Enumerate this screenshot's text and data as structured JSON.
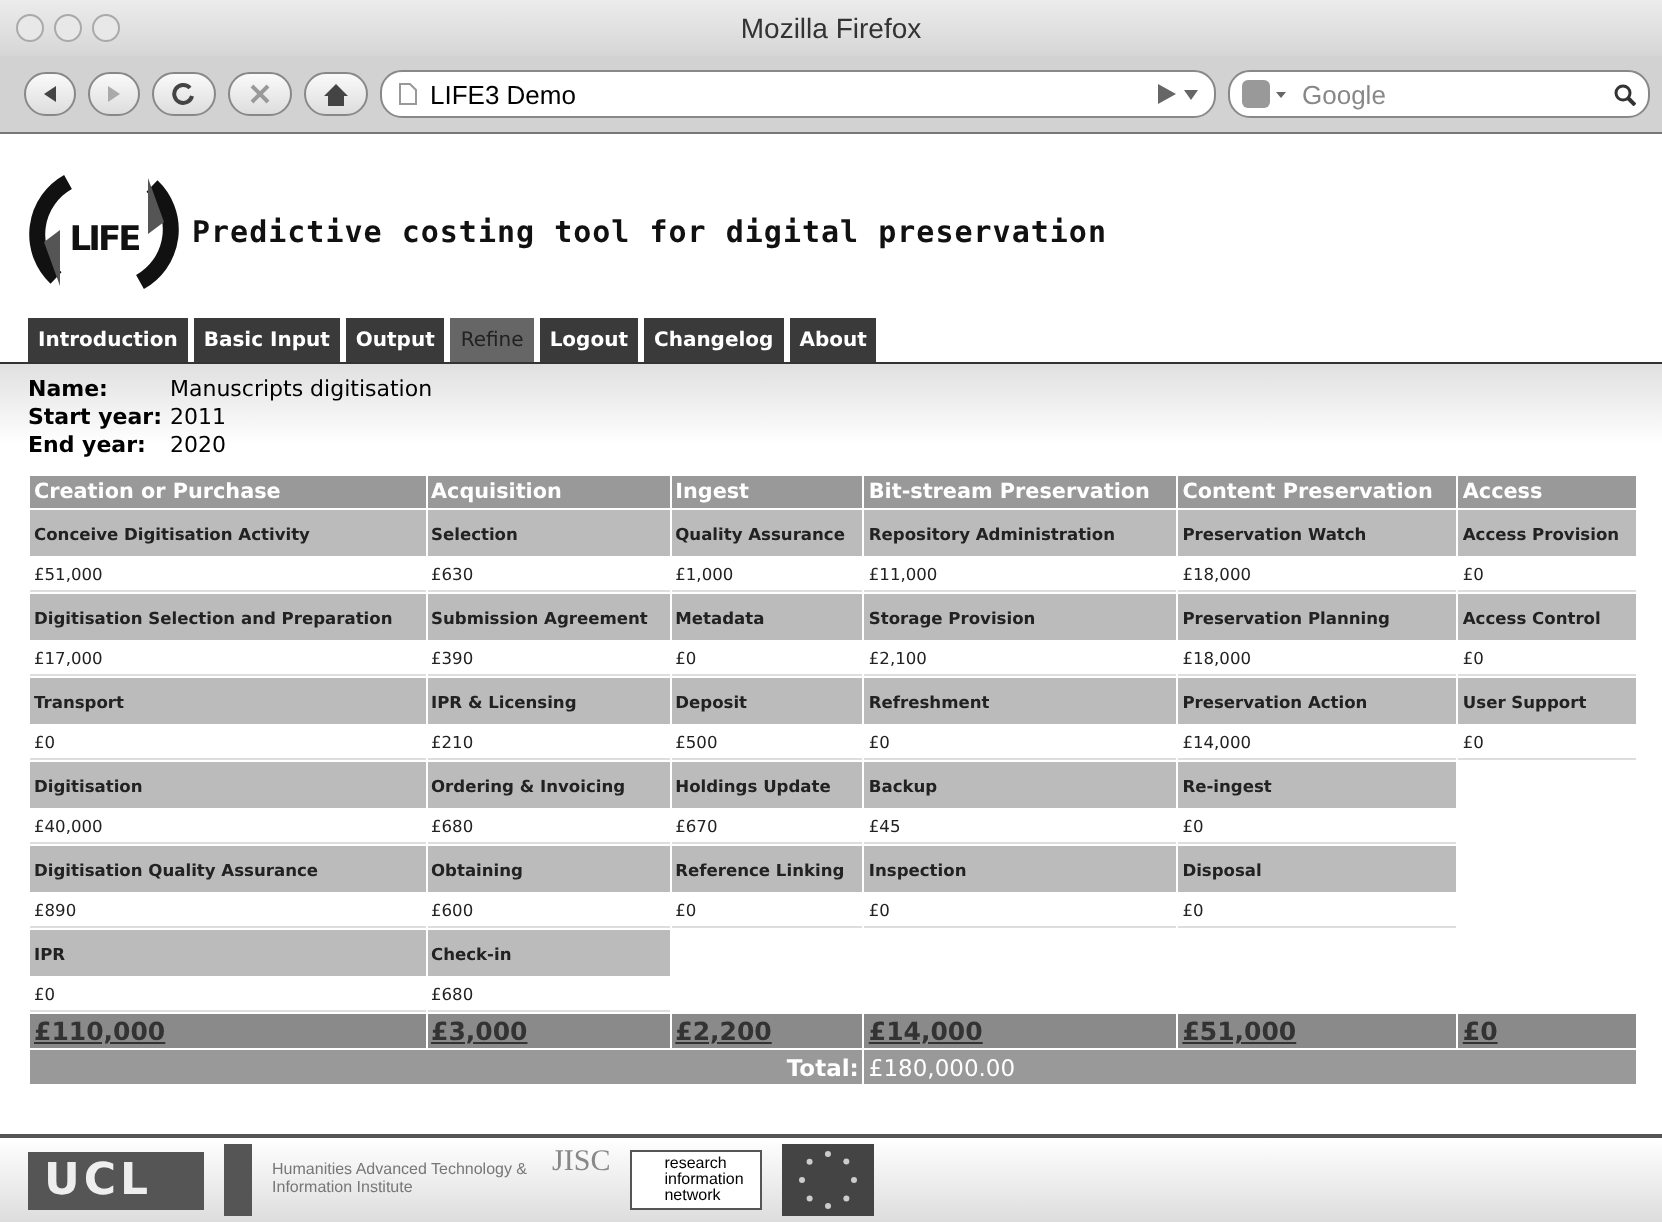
{
  "window": {
    "title": "Mozilla Firefox"
  },
  "toolbar": {
    "address": "LIFE3 Demo",
    "search": {
      "placeholder": "Google"
    }
  },
  "header": {
    "logo": "LIFE",
    "title": "Predictive costing tool for digital preservation"
  },
  "tabs": [
    {
      "label": "Introduction",
      "selected": false
    },
    {
      "label": "Basic Input",
      "selected": false
    },
    {
      "label": "Output",
      "selected": false
    },
    {
      "label": "Refine",
      "selected": true
    },
    {
      "label": "Logout",
      "selected": false
    },
    {
      "label": "Changelog",
      "selected": false
    },
    {
      "label": "About",
      "selected": false
    }
  ],
  "project": [
    {
      "label": "Name:",
      "value": "Manuscripts digitisation"
    },
    {
      "label": "Start year:",
      "value": "2011"
    },
    {
      "label": "End year:",
      "value": "2020"
    }
  ],
  "table": {
    "columns": [
      {
        "heading": "Creation or Purchase",
        "total": "£110,000",
        "items": [
          {
            "label": "Conceive Digitisation Activity",
            "value": "£51,000"
          },
          {
            "label": "Digitisation Selection and Preparation",
            "value": "£17,000"
          },
          {
            "label": "Transport",
            "value": "£0"
          },
          {
            "label": "Digitisation",
            "value": "£40,000"
          },
          {
            "label": "Digitisation Quality Assurance",
            "value": "£890"
          },
          {
            "label": "IPR",
            "value": "£0"
          }
        ]
      },
      {
        "heading": "Acquisition",
        "total": "£3,000",
        "items": [
          {
            "label": "Selection",
            "value": "£630"
          },
          {
            "label": "Submission Agreement",
            "value": "£390"
          },
          {
            "label": "IPR & Licensing",
            "value": "£210"
          },
          {
            "label": "Ordering & Invoicing",
            "value": "£680"
          },
          {
            "label": "Obtaining",
            "value": "£600"
          },
          {
            "label": "Check-in",
            "value": "£680"
          }
        ]
      },
      {
        "heading": "Ingest",
        "total": "£2,200",
        "items": [
          {
            "label": "Quality Assurance",
            "value": "£1,000"
          },
          {
            "label": "Metadata",
            "value": "£0"
          },
          {
            "label": "Deposit",
            "value": "£500"
          },
          {
            "label": "Holdings Update",
            "value": "£670"
          },
          {
            "label": "Reference Linking",
            "value": "£0"
          }
        ]
      },
      {
        "heading": "Bit-stream Preservation",
        "total": "£14,000",
        "items": [
          {
            "label": "Repository Administration",
            "value": "£11,000"
          },
          {
            "label": "Storage Provision",
            "value": "£2,100"
          },
          {
            "label": "Refreshment",
            "value": "£0"
          },
          {
            "label": "Backup",
            "value": "£45"
          },
          {
            "label": "Inspection",
            "value": "£0"
          }
        ]
      },
      {
        "heading": "Content Preservation",
        "total": "£51,000",
        "items": [
          {
            "label": "Preservation Watch",
            "value": "£18,000"
          },
          {
            "label": "Preservation Planning",
            "value": "£18,000"
          },
          {
            "label": "Preservation Action",
            "value": "£14,000"
          },
          {
            "label": "Re-ingest",
            "value": "£0"
          },
          {
            "label": "Disposal",
            "value": "£0"
          }
        ]
      },
      {
        "heading": "Access",
        "total": "£0",
        "items": [
          {
            "label": "Access Provision",
            "value": "£0"
          },
          {
            "label": "Access Control",
            "value": "£0"
          },
          {
            "label": "User Support",
            "value": "£0"
          }
        ]
      }
    ],
    "grand_total": {
      "label": "Total:",
      "value": "£180,000.00"
    }
  },
  "footer": {
    "logos": [
      {
        "kind": "ucl",
        "text": "UCL"
      },
      {
        "kind": "library"
      },
      {
        "kind": "hatii",
        "text": "Humanities Advanced Technology & Information Institute"
      },
      {
        "kind": "jisc",
        "text": "JISC"
      },
      {
        "kind": "rin",
        "text": "research information network"
      },
      {
        "kind": "liber"
      }
    ]
  }
}
